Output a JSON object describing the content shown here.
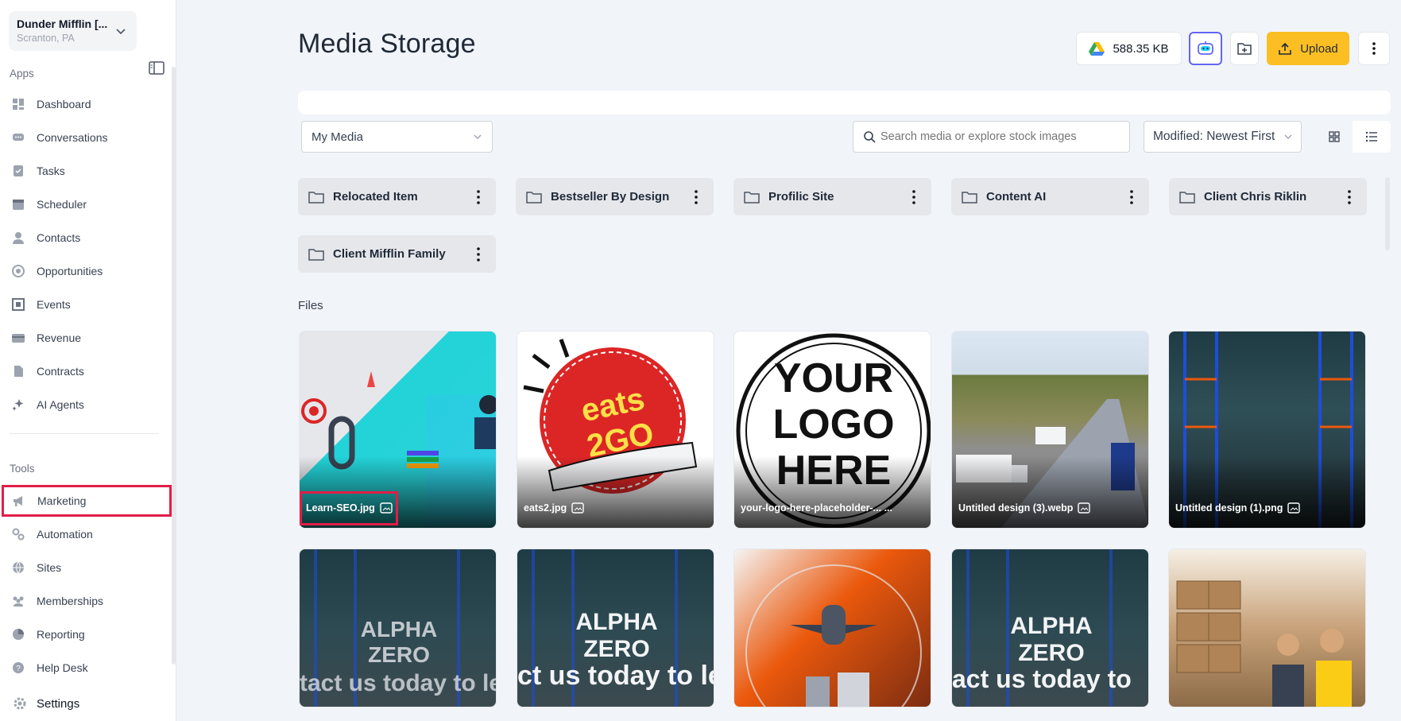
{
  "account": {
    "name": "Dunder Mifflin [...",
    "location": "Scranton, PA"
  },
  "sidebar": {
    "apps_label": "Apps",
    "apps": [
      {
        "label": "Dashboard",
        "icon": "dashboard-icon"
      },
      {
        "label": "Conversations",
        "icon": "chat-icon"
      },
      {
        "label": "Tasks",
        "icon": "tasks-icon"
      },
      {
        "label": "Scheduler",
        "icon": "calendar-icon"
      },
      {
        "label": "Contacts",
        "icon": "person-icon"
      },
      {
        "label": "Opportunities",
        "icon": "target-icon"
      },
      {
        "label": "Events",
        "icon": "events-icon"
      },
      {
        "label": "Revenue",
        "icon": "card-icon"
      },
      {
        "label": "Contracts",
        "icon": "document-icon"
      },
      {
        "label": "AI Agents",
        "icon": "sparkle-icon"
      }
    ],
    "tools_label": "Tools",
    "tools": [
      {
        "label": "Marketing",
        "icon": "megaphone-icon"
      },
      {
        "label": "Automation",
        "icon": "gears-icon"
      },
      {
        "label": "Sites",
        "icon": "globe-icon"
      },
      {
        "label": "Memberships",
        "icon": "users-icon"
      },
      {
        "label": "Reporting",
        "icon": "pie-chart-icon"
      },
      {
        "label": "Help Desk",
        "icon": "help-icon"
      }
    ],
    "settings_label": "Settings"
  },
  "header": {
    "title": "Media Storage",
    "storage_used": "588.35 KB",
    "upload_label": "Upload"
  },
  "toolbar": {
    "media_filter": "My Media",
    "search_placeholder": "Search media or explore stock images",
    "sort": "Modified: Newest First"
  },
  "folders": [
    "Relocated Item",
    "Bestseller By Design",
    "Profilic Site",
    "Content AI",
    "Client Chris Riklin",
    "Client Mifflin Family"
  ],
  "files_label": "Files",
  "files": [
    {
      "name": "Learn-SEO.jpg",
      "image_text": ""
    },
    {
      "name": "eats2.jpg",
      "image_text": "eats 2GO"
    },
    {
      "name": "your-logo-here-placeholder-... ...",
      "image_text": "YOUR LOGO HERE"
    },
    {
      "name": "Untitled design (3).webp",
      "image_text": ""
    },
    {
      "name": "Untitled design (1).png",
      "image_text": ""
    },
    {
      "name": "",
      "image_text": "ALPHA ZERO"
    },
    {
      "name": "",
      "image_text": "ALPHA ZERO"
    },
    {
      "name": "",
      "image_text": ""
    },
    {
      "name": "",
      "image_text": "ALPHA ZERO"
    },
    {
      "name": "",
      "image_text": ""
    }
  ],
  "overlay_texts": [
    "tact us today to le",
    "ct us today to le",
    "act us today to"
  ],
  "colors": {
    "accent": "#fbbf24",
    "highlight": "#e11d48",
    "ai_border": "#6366f1"
  }
}
